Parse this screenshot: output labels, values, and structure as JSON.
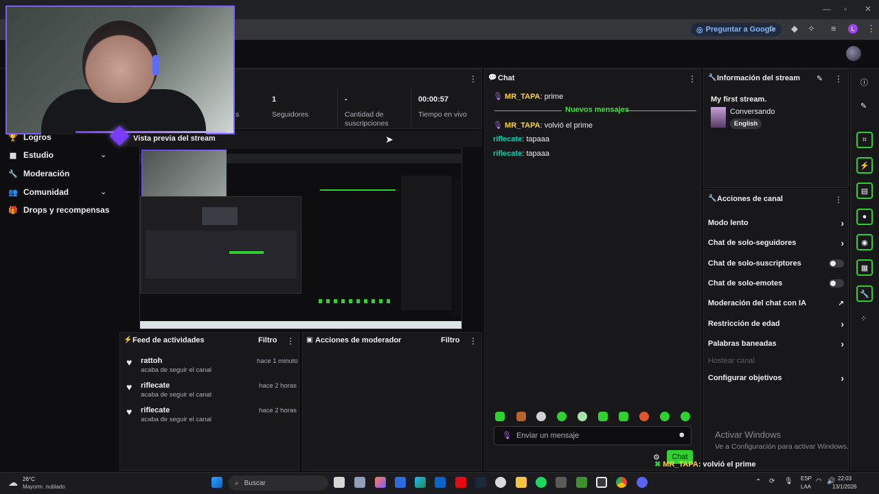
{
  "browser": {
    "ask_google": "Preguntar a Google",
    "profile_initial": "L"
  },
  "sidebar": {
    "items": [
      {
        "label": "Logros",
        "icon": "trophy-icon"
      },
      {
        "label": "Estudio",
        "icon": "studio-icon"
      },
      {
        "label": "Moderación",
        "icon": "wrench-icon"
      },
      {
        "label": "Comunidad",
        "icon": "people-icon"
      },
      {
        "label": "Drops y recompensas",
        "icon": "gift-icon"
      }
    ]
  },
  "stats": {
    "partial_label": "s",
    "followers_value": "1",
    "followers_label": "Seguidores",
    "subs_value": "-",
    "subs_label": "Cantidad de suscripciones",
    "live_value": "00:00:57",
    "live_label": "Tiempo en vivo"
  },
  "preview": {
    "title": "Vista previa del stream"
  },
  "feed": {
    "title": "Feed de actividades",
    "filter": "Filtro",
    "items": [
      {
        "name": "rattoh",
        "sub": "acaba de seguir el canal",
        "time": "hace 1 minuto"
      },
      {
        "name": "riflecate",
        "sub": "acaba de seguir el canal",
        "time": "hace 2 horas"
      },
      {
        "name": "riflecate",
        "sub": "acaba de seguir el canal",
        "time": "hace 2 horas"
      }
    ]
  },
  "mod_actions": {
    "title": "Acciones de moderador",
    "filter": "Filtro"
  },
  "chat": {
    "title": "Chat",
    "messages": [
      {
        "user": "MR_TAPA",
        "text": ": prime"
      },
      {
        "user": "MR_TAPA",
        "text": ": volvió el prime"
      },
      {
        "user": "riflecate",
        "text": ": tapaaa"
      },
      {
        "user": "riflecate",
        "text": ": tapaaa"
      }
    ],
    "new_messages": "Nuevos mensajes",
    "input_placeholder": "Enviar un mensaje",
    "send_label": "Chat",
    "overlay_user": "MR_TAPA",
    "overlay_text": ": volvió el prime"
  },
  "stream_info": {
    "title": "Información del stream",
    "stream_title": "My first stream.",
    "category": "Conversando",
    "tag": "English"
  },
  "channel_actions": {
    "title": "Acciones de canal",
    "items": [
      {
        "label": "Modo lento"
      },
      {
        "label": "Chat de solo-seguidores"
      },
      {
        "label": "Chat de solo-suscriptores"
      },
      {
        "label": "Chat de solo-emotes"
      },
      {
        "label": "Moderación del chat con IA"
      },
      {
        "label": "Restricción de edad"
      },
      {
        "label": "Palabras baneadas"
      },
      {
        "label": "Hostear canal"
      },
      {
        "label": "Configurar objetivos"
      }
    ]
  },
  "windows": {
    "activate_title": "Activar Windows",
    "activate_sub": "Ve a Configuración para activar Windows."
  },
  "taskbar": {
    "weather_temp": "26°C",
    "weather_desc": "Mayorm. nublado",
    "search": "Buscar",
    "lang1": "ESP",
    "lang2": "LAA",
    "time": "22:03",
    "date": "13/1/2026"
  },
  "colors": {
    "accent_green": "#2ed12e",
    "accent_purple": "#7a3cff",
    "user_yellow": "#ffd23f",
    "user_teal": "#00d6b4"
  }
}
